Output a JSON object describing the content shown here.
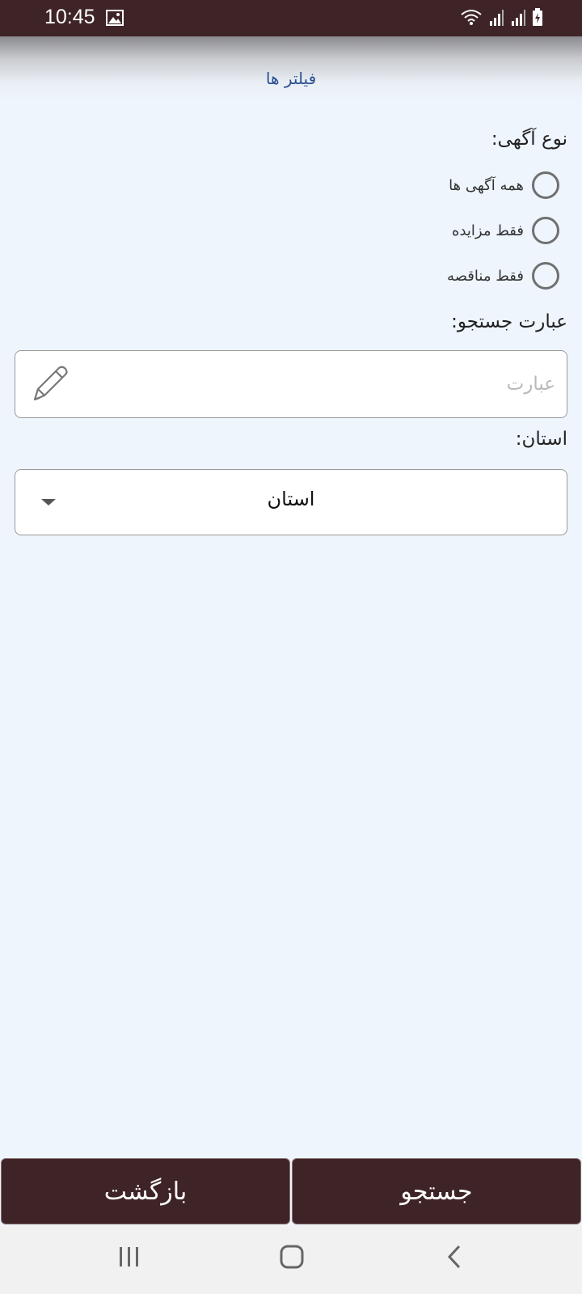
{
  "status_bar": {
    "time": "10:45",
    "icons": [
      "gallery-icon",
      "wifi-icon",
      "signal-icon",
      "signal-icon",
      "battery-charging-icon"
    ]
  },
  "header": {
    "title": "فیلتر ها"
  },
  "ad_type": {
    "label": "نوع آگهی:",
    "options": [
      "همه آگهی ها",
      "فقط مزایده",
      "فقط مناقصه"
    ]
  },
  "search": {
    "label": "عبارت جستجو:",
    "placeholder": "عبارت",
    "value": "",
    "icon": "pencil-icon"
  },
  "province": {
    "label": "استان:",
    "selected": "استان",
    "icon": "dropdown-arrow-icon"
  },
  "buttons": {
    "back_label": "بازگشت",
    "search_label": "جستجو"
  },
  "nav_bar": {
    "icons": [
      "recent-apps-icon",
      "home-icon",
      "back-icon"
    ]
  },
  "colors": {
    "primary": "#3f2427",
    "background": "#eef5fd",
    "header_title": "#2b4f8f"
  }
}
